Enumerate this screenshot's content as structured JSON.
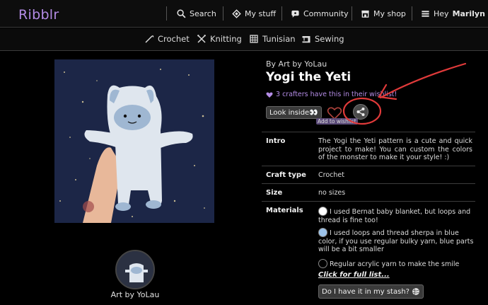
{
  "app": {
    "logo": "Ribblr"
  },
  "topnav": {
    "search": "Search",
    "my_stuff": "My stuff",
    "community": "Community",
    "my_shop": "My shop",
    "greeting": "Hey",
    "username": "Marilyn"
  },
  "subnav": [
    "Crochet",
    "Knitting",
    "Tunisian",
    "Sewing"
  ],
  "pattern": {
    "by_line": "By Art by YoLau",
    "title": "Yogi the Yeti",
    "wishlist_count": "3 crafters have this in their wishlist!",
    "look_inside": "Look inside👀",
    "add_to_wishlist": "Add to wishlist",
    "intro_label": "Intro",
    "intro": "The Yogi the Yeti pattern is a cute and quick project to make! You can custom the colors of the monster to make it your style! :)",
    "craft_type_label": "Craft type",
    "craft_type": "Crochet",
    "size_label": "Size",
    "size": "no sizes",
    "materials_label": "Materials",
    "materials": [
      {
        "text": "I used Bernat baby blanket, but loops and thread is fine too!",
        "color": "#ffffff"
      },
      {
        "text": "I used loops and thread sherpa in blue color, if you use regular bulky yarn, blue parts will be a bit smaller",
        "color": "#9cc3ea"
      },
      {
        "text": "Regular acrylic yarn to make the smile",
        "color": "#000000"
      }
    ],
    "full_list": "Click for full list...",
    "stash_button": "Do I have it in my stash?"
  },
  "designer": {
    "name": "Art by YoLau"
  },
  "colors": {
    "accent": "#b48ce6",
    "annotation": "#e03a3a"
  }
}
